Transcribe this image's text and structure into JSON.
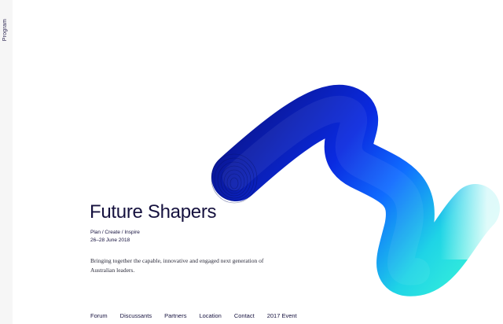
{
  "side_nav": {
    "label": "Program"
  },
  "hero": {
    "title": "Future Shapers",
    "tagline": "Plan / Create / Inspire",
    "dates": "26–28 June 2018",
    "description": "Bringing together the capable, innovative and engaged next generation of Australian leaders."
  },
  "footer_nav": {
    "items": [
      "Forum",
      "Discussants",
      "Partners",
      "Location",
      "Contact",
      "2017 Event"
    ]
  },
  "colors": {
    "text": "#16123f",
    "ribbon_dark": "#0b1b9c",
    "ribbon_mid": "#1452ff",
    "ribbon_light": "#2ff2dc",
    "rail": "#f6f6f6"
  }
}
